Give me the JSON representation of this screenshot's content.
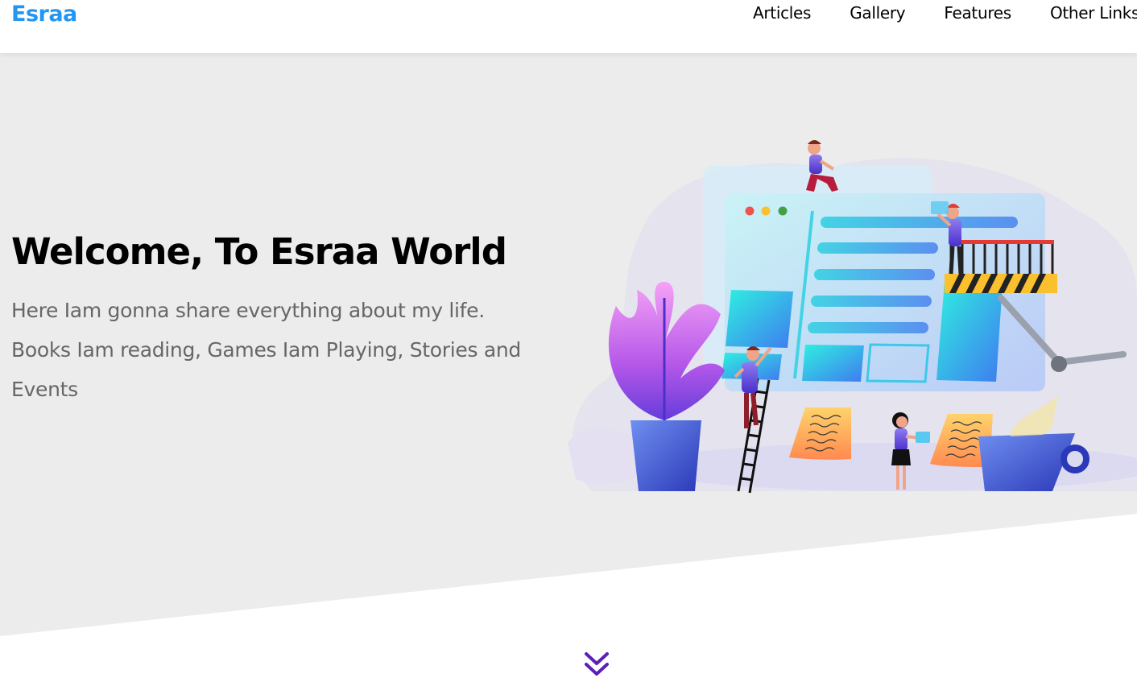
{
  "header": {
    "logo": "Esraa",
    "nav": [
      {
        "label": "Articles"
      },
      {
        "label": "Gallery"
      },
      {
        "label": "Features"
      },
      {
        "label": "Other Links"
      }
    ]
  },
  "landing": {
    "title": "Welcome, To Esraa World",
    "description": "Here Iam gonna share everything about my life. Books Iam reading, Games Iam Playing, Stories and Events"
  },
  "icons": {
    "scroll_down": "double-chevron-down-icon"
  },
  "colors": {
    "brand": "#2196f3",
    "landing_background": "#ececec",
    "text_muted": "#666666",
    "accent_purple": "#5b21b6"
  }
}
